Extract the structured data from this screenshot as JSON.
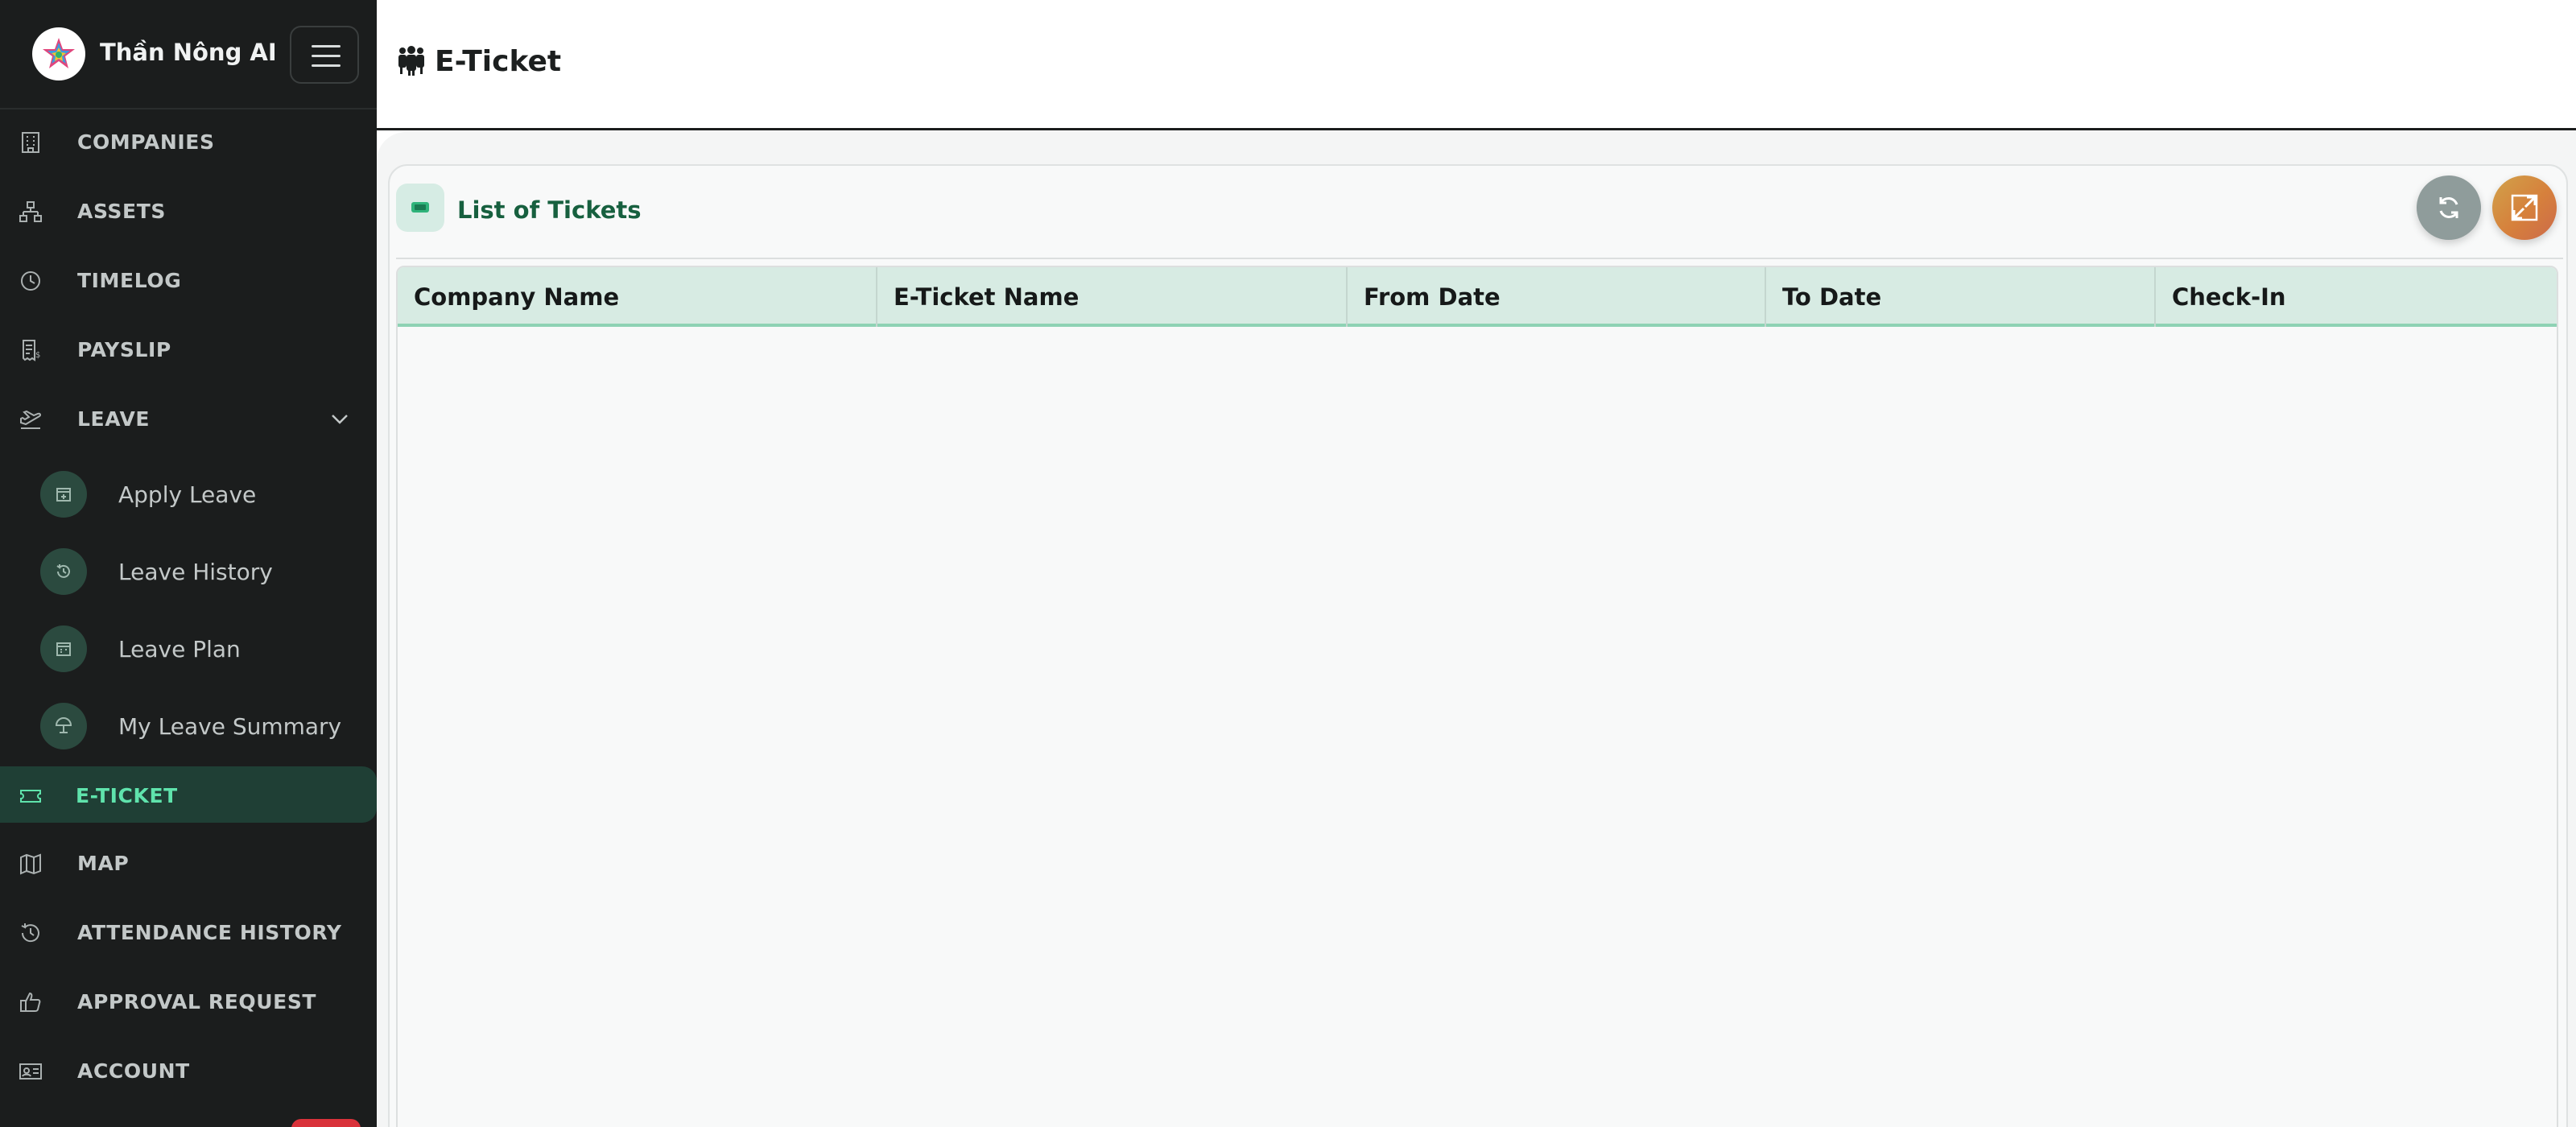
{
  "app": {
    "brand_name": "Thần Nông AI"
  },
  "sidebar": {
    "items": [
      {
        "label": "COMPANIES",
        "icon": "building-icon"
      },
      {
        "label": "ASSETS",
        "icon": "hierarchy-icon"
      },
      {
        "label": "TIMELOG",
        "icon": "clock-icon"
      },
      {
        "label": "PAYSLIP",
        "icon": "receipt-icon"
      },
      {
        "label": "LEAVE",
        "icon": "plane-departure-icon",
        "expanded": true
      },
      {
        "label": "E-TICKET",
        "icon": "ticket-icon",
        "active": true
      },
      {
        "label": "MAP",
        "icon": "map-icon"
      },
      {
        "label": "ATTENDANCE HISTORY",
        "icon": "history-icon"
      },
      {
        "label": "APPROVAL REQUEST",
        "icon": "thumbs-up-icon"
      },
      {
        "label": "ACCOUNT",
        "icon": "id-card-icon"
      }
    ],
    "leave_subitems": [
      {
        "label": "Apply Leave",
        "icon": "calendar-plus-icon"
      },
      {
        "label": "Leave History",
        "icon": "history-icon"
      },
      {
        "label": "Leave Plan",
        "icon": "calendar-icon"
      },
      {
        "label": "My Leave Summary",
        "icon": "umbrella-beach-icon"
      }
    ]
  },
  "header": {
    "title": "E-Ticket",
    "icon": "people-group-icon"
  },
  "card": {
    "title": "List of Tickets",
    "icon": "ticket-icon"
  },
  "table": {
    "columns": [
      "Company Name",
      "E-Ticket Name",
      "From Date",
      "To Date",
      "Check-In"
    ],
    "rows": []
  },
  "colors": {
    "sidebar_bg": "#1b1d1d",
    "active_bg": "#1f3f35",
    "active_text": "#5fe3ac",
    "accent_green": "#17603f",
    "table_header_bg": "#d7ebe3"
  }
}
